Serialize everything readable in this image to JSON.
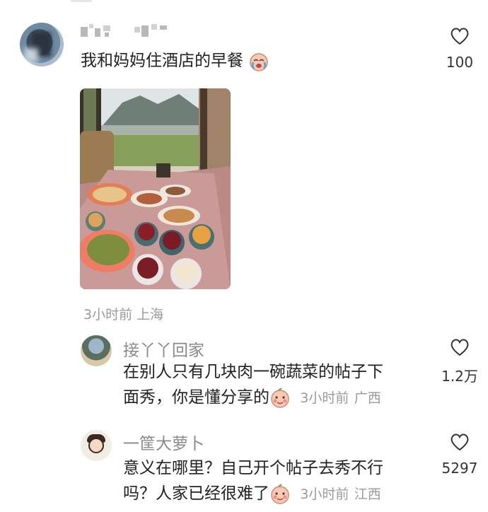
{
  "post": {
    "text": "我和妈妈住酒店的早餐",
    "likes": "100",
    "time": "3小时前",
    "location": "上海"
  },
  "replies": [
    {
      "username": "接丫丫回家",
      "line1": "在别人只有几块肉一碗蔬菜的帖子下",
      "line2": "面秀，你是懂分享的",
      "time": "3小时前",
      "location": "广西",
      "likes": "1.2万"
    },
    {
      "username": "一筐大萝卜",
      "line1": "意义在哪里？自己开个帖子去秀不行",
      "line2": "吗？人家已经很难了",
      "time": "3小时前",
      "location": "江西",
      "likes": "5297"
    }
  ],
  "icons": {
    "like": "heart-outline-icon",
    "emoji_crying": "crying-face-icon",
    "emoji_shy": "shy-face-icon"
  }
}
